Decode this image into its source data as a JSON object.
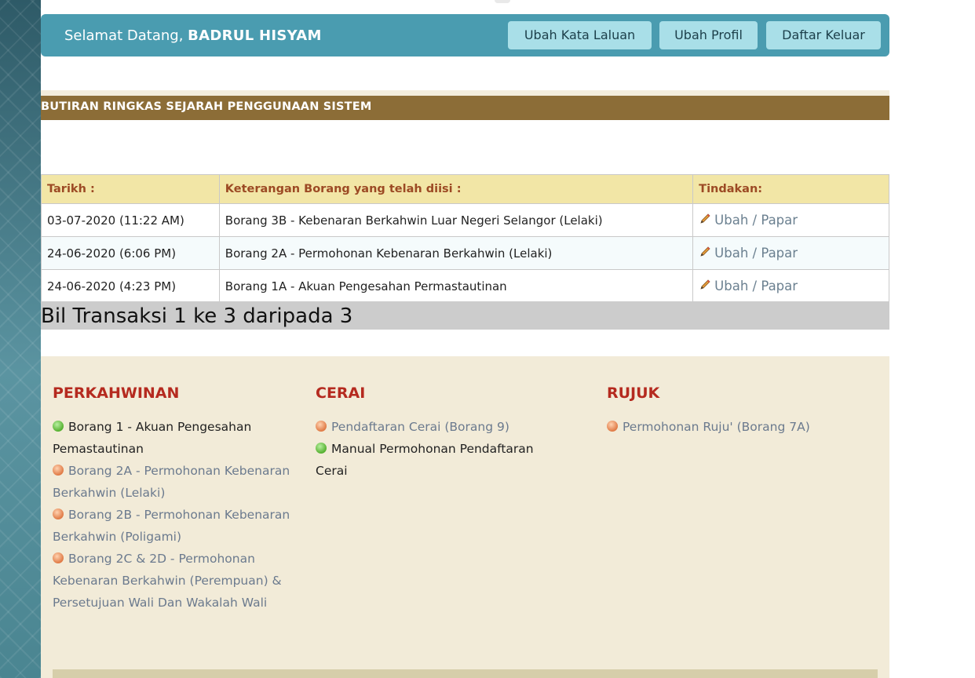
{
  "header": {
    "welcome_prefix": "Selamat Datang, ",
    "user_name": "BADRUL HISYAM",
    "buttons": [
      "Ubah Kata Laluan",
      "Ubah Profil",
      "Daftar Keluar"
    ]
  },
  "history": {
    "title": "BUTIRAN RINGKAS SEJARAH PENGGUNAAN SISTEM",
    "columns": [
      "Tarikh :",
      "Keterangan Borang yang telah diisi :",
      "Tindakan:"
    ],
    "rows": [
      {
        "date": "03-07-2020 (11:22 AM)",
        "desc": "Borang 3B - Kebenaran Berkahwin Luar Negeri Selangor (Lelaki)",
        "action_edit": "Ubah",
        "action_sep": " / ",
        "action_view": "Papar"
      },
      {
        "date": "24-06-2020 (6:06 PM)",
        "desc": "Borang 2A - Permohonan Kebenaran Berkahwin (Lelaki)",
        "action_edit": "Ubah",
        "action_sep": " / ",
        "action_view": "Papar"
      },
      {
        "date": "24-06-2020 (4:23 PM)",
        "desc": "Borang 1A - Akuan Pengesahan Permastautinan",
        "action_edit": "Ubah",
        "action_sep": " / ",
        "action_view": "Papar"
      }
    ],
    "summary": "Bil Transaksi 1 ke 3 daripada 3"
  },
  "menu": {
    "perkahwinan": {
      "title": "PERKAHWINAN",
      "items": [
        {
          "label": "Borang 1 - Akuan Pengesahan Pemastautinan",
          "status": "green",
          "link": false
        },
        {
          "label": "Borang 2A - Permohonan Kebenaran Berkahwin (Lelaki)",
          "status": "orange",
          "link": true
        },
        {
          "label": "Borang 2B - Permohonan Kebenaran Berkahwin (Poligami)",
          "status": "orange",
          "link": true
        },
        {
          "label": "Borang 2C & 2D - Permohonan Kebenaran Berkahwin (Perempuan) & Persetujuan Wali Dan Wakalah Wali",
          "status": "orange",
          "link": true
        }
      ]
    },
    "cerai": {
      "title": "CERAI",
      "items": [
        {
          "label": "Pendaftaran Cerai (Borang 9)",
          "status": "orange",
          "link": true
        },
        {
          "label": "Manual Permohonan Pendaftaran Cerai",
          "status": "green",
          "link": false
        }
      ]
    },
    "rujuk": {
      "title": "RUJUK",
      "items": [
        {
          "label": "Permohonan Ruju' (Borang 7A)",
          "status": "orange",
          "link": true
        }
      ]
    }
  },
  "colors": {
    "top_bar": "#4a9cb0",
    "section_bar": "#8c6d37",
    "table_header_bg": "#f2e6a6",
    "heading_red": "#b52a1f"
  }
}
